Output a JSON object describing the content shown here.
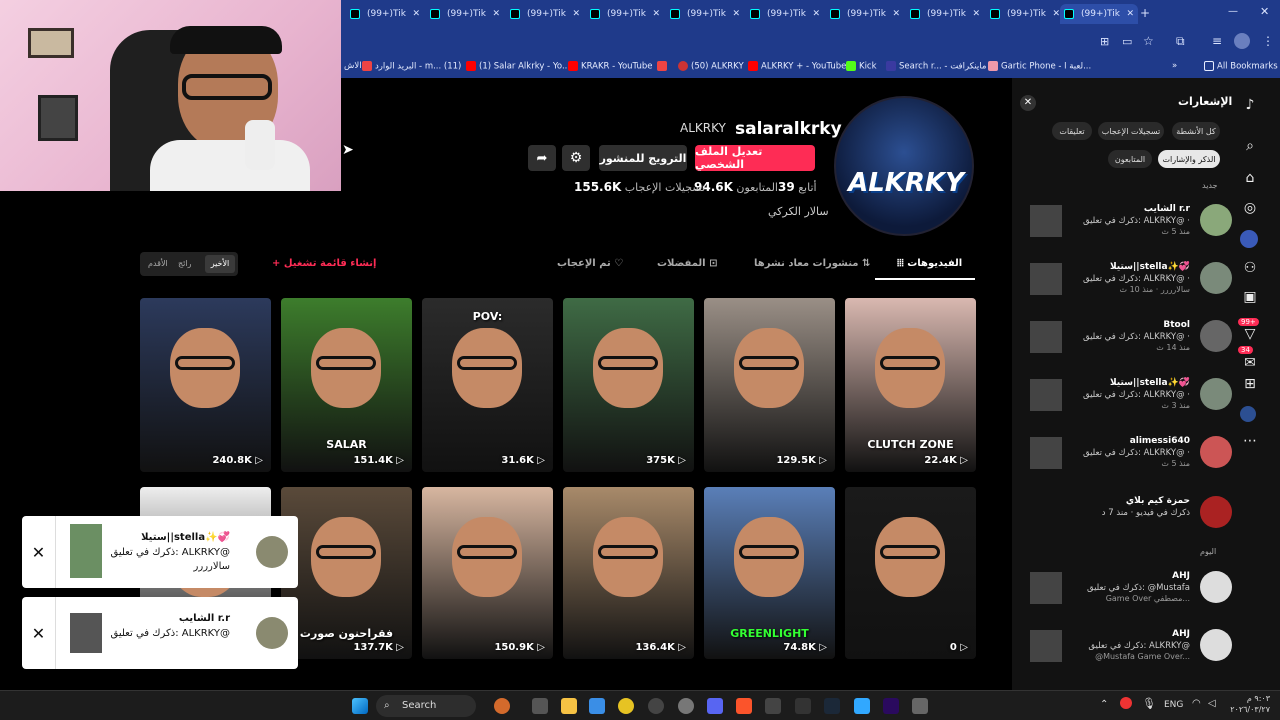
{
  "browser": {
    "tab_label": "(99+)Tik",
    "bookmarks": [
      {
        "label": "البريد الوارد - m... (11)"
      },
      {
        "label": "(1) Salar Alkrky - Yo..."
      },
      {
        "label": "KRAKR - YouTube"
      },
      {
        "label": "(50) ALKRKY"
      },
      {
        "label": "ALKRKY + - YouTube"
      },
      {
        "label": "Kick"
      },
      {
        "label": "Search r... - ماينكرافت"
      },
      {
        "label": "Gartic Phone - لعبة ا..."
      }
    ],
    "bookmarks_prefix": "الاش",
    "all_bookmarks": "All Bookmarks"
  },
  "profile": {
    "username": "salaralkrky",
    "nickname": "ALKRKY",
    "edit_button": "تعديل الملف الشخصي",
    "promote_button": "الترويج للمنشور",
    "following_value": "39",
    "following_label": "أتابع",
    "followers_value": "94.6K",
    "followers_label": "المتابعون",
    "likes_value": "155.6K",
    "likes_label": "تسجيلات الإعجاب",
    "bio": "سالار الكركي",
    "avatar_text": "ALKRKY"
  },
  "tabs": {
    "videos": "الفيديوهات",
    "reposts": "منشورات معاد نشرها",
    "favorites": "المفضلات",
    "liked": "تم الإعجاب",
    "create_playlist": "+ إنشاء قائمة تشغيل",
    "sort": [
      "الأخير",
      "رائج",
      "الأقدم"
    ]
  },
  "videos": [
    {
      "count": "22.4K",
      "overlay": "CLUTCH ZONE",
      "bg": "#d9b8b0"
    },
    {
      "count": "129.5K",
      "overlay": "",
      "bg": "#9a8f86"
    },
    {
      "count": "375K",
      "overlay": "",
      "bg": "#3f6b45"
    },
    {
      "count": "31.6K",
      "overlay": "POV:",
      "bg": "#2b2b2b"
    },
    {
      "count": "151.4K",
      "overlay": "SALAR",
      "bg": "#3d7d2c"
    },
    {
      "count": "240.8K",
      "overlay": "",
      "bg": "#2c3a5c"
    },
    {
      "count": "0",
      "overlay": "",
      "bg": "#1a1a1a"
    },
    {
      "count": "74.8K",
      "overlay": "GREENLIGHT",
      "bg": "#5a7fb8"
    },
    {
      "count": "136.4K",
      "overlay": "",
      "bg": "#a88a6a"
    },
    {
      "count": "150.9K",
      "overlay": "",
      "bg": "#d7b6a0"
    },
    {
      "count": "137.7K",
      "overlay": "فقراحنون صورت",
      "bg": "#5a4a3a"
    },
    {
      "count": "",
      "overlay": "",
      "bg": "#eeeeee"
    }
  ],
  "sidebar": {
    "title": "الإشعارات",
    "filters": [
      "كل الأنشطة",
      "تسجيلات الإعجاب",
      "تعليقات",
      "الذكر والإشارات",
      "المتابعون"
    ],
    "section_new": "جديد",
    "section_today": "اليوم",
    "notifications": [
      {
        "name": "الشايب r.r",
        "sub": "ذكرك في تعليق: ALKRKY@ ·",
        "time": "منذ 5 ث"
      },
      {
        "name": "ستيلا||stella✨💞",
        "sub": "ذكرك في تعليق: ALKRKY@ ·",
        "time": "سالارررر · منذ 10 ث"
      },
      {
        "name": "Btool",
        "sub": "ذكرك في تعليق: ALKRKY@ ·",
        "time": "منذ 14 ث"
      },
      {
        "name": "ستيلا||stella✨💞",
        "sub": "ذكرك في تعليق: ALKRKY@ ·",
        "time": "منذ 3 ث"
      },
      {
        "name": "alimessi640",
        "sub": "ذكرك في تعليق: ALKRKY@ ·",
        "time": "منذ 5 ث"
      },
      {
        "name": "حمزة كيم بلاي",
        "sub": "ذكرك في فيديو · منذ 7 د",
        "time": ""
      },
      {
        "name": "AHJ",
        "sub": "ذكرك في تعليق: @Mustafa",
        "time": "Game Over مصطفي..."
      },
      {
        "name": "AHJ",
        "sub": "ذكرك في تعليق: ALKRKY@",
        "time": "@Mustafa Game Over..."
      }
    ],
    "badge_inbox": "99+",
    "badge_messages": "34"
  },
  "popups": [
    {
      "name": "ستيلا||stella✨💞",
      "sub": "ذكرك في تعليق: ALKRKY@",
      "sub2": "سالارررر"
    },
    {
      "name": "الشايب r.r",
      "sub": "ذكرك في تعليق: ALKRKY@",
      "sub2": ""
    }
  ],
  "taskbar": {
    "search": "Search",
    "lang": "ENG",
    "time": "٩:٠٣ م",
    "date": "٢٠٢٦/٠٣/٢٧"
  },
  "colors": {
    "accent": "#fe2c55",
    "tab_blue": "#1f3a8a"
  }
}
